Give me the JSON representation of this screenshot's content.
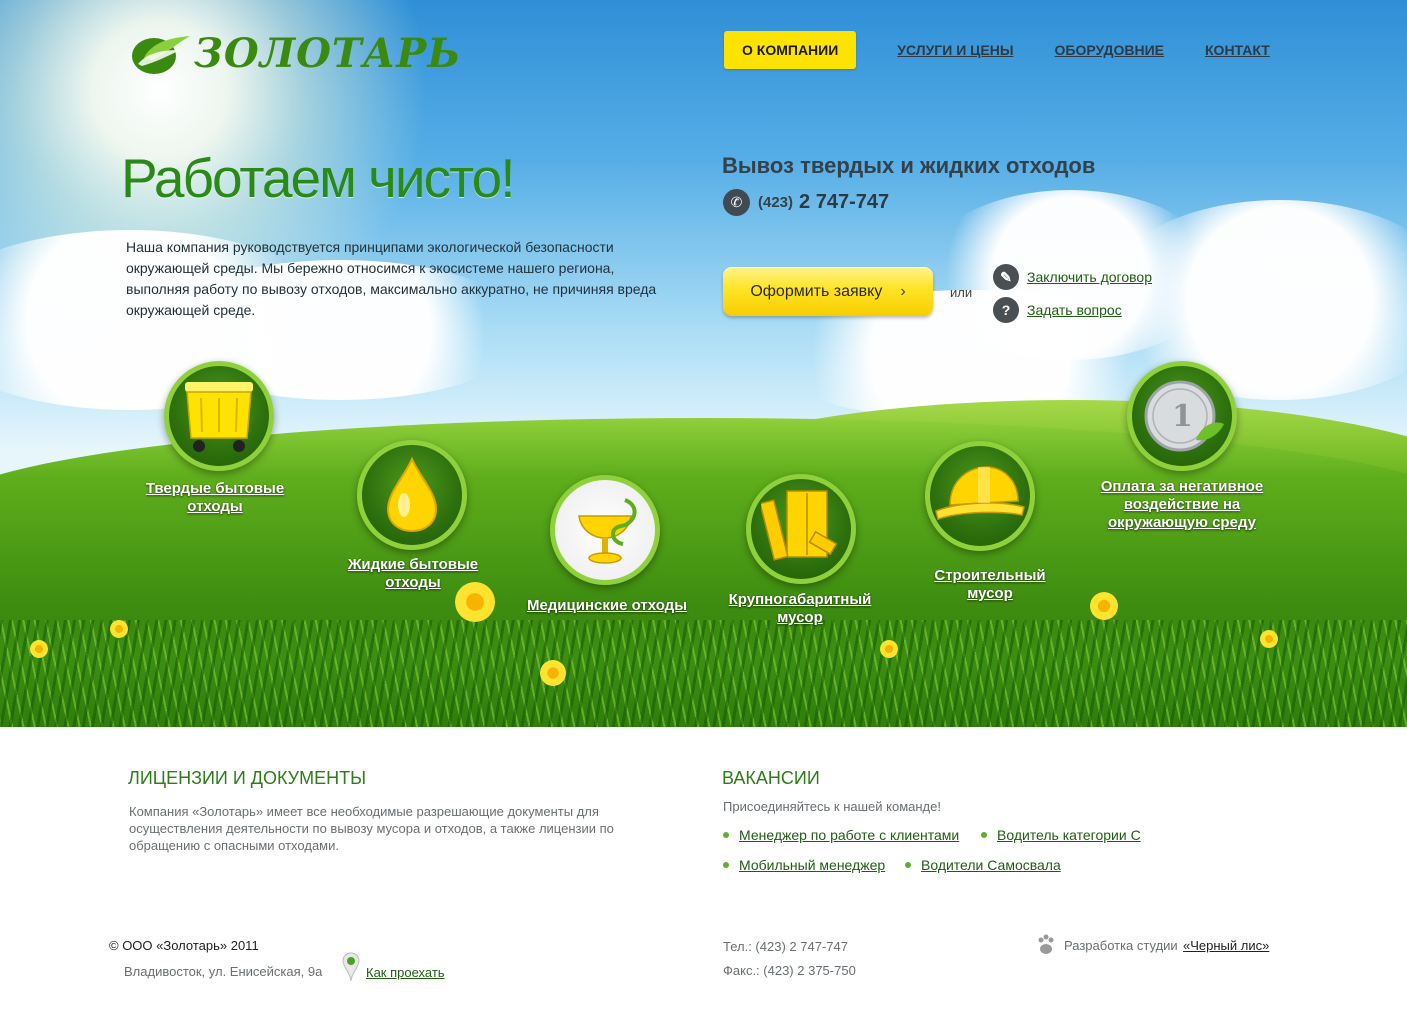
{
  "brand": {
    "name": "ЗОЛОТАРЬ"
  },
  "nav": [
    {
      "label": "О КОМПАНИИ",
      "active": true
    },
    {
      "label": "УСЛУГИ И ЦЕНЫ"
    },
    {
      "label": "ОБОРУДОВНИЕ"
    },
    {
      "label": "КОНТАКТ"
    }
  ],
  "hero": {
    "headline": "Работаем чисто!",
    "intro": "Наша компания руководствуется принципами экологической безопасности окружающей среды. Мы бережно относимся к экосистеме нашего региона, выполняя работу по вывозу отходов, максимально аккуратно, не причиняя вреда окружающей среде.",
    "service_title": "Вывоз твердых и жидких отходов",
    "phone_code": "(423)",
    "phone_number": "2 747-747",
    "order_button": "Оформить заявку",
    "or_text": "или",
    "contract_link": "Заключить договор",
    "question_link": "Задать вопрос"
  },
  "categories": [
    {
      "label": "Твердые бытовые отходы",
      "icon": "garbage-container-icon"
    },
    {
      "label": "Жидкие бытовые отходы",
      "icon": "liquid-drop-icon"
    },
    {
      "label": "Медицинские отходы",
      "icon": "medical-bowl-icon"
    },
    {
      "label": "Крупногабаритный мусор",
      "icon": "furniture-icon"
    },
    {
      "label": "Строительный мусор",
      "icon": "hard-hat-icon"
    },
    {
      "label": "Оплата за негативное воздействие на окружающую среду",
      "icon": "ruble-coin-icon"
    }
  ],
  "licenses": {
    "title": "ЛИЦЕНЗИИ И ДОКУМЕНТЫ",
    "text": "Компания «Золотарь» имеет все необходимые разрешающие документы для осуществления деятельности по вывозу мусора и отходов, а также лицензии по обращению с опасными отходами."
  },
  "vacancies": {
    "title": "ВАКАНСИИ",
    "subtitle": "Присоединяйтесь к нашей команде!",
    "items": [
      "Менеджер по работе с клиентами",
      "Водитель категории С",
      "Мобильный менеджер",
      "Водители Самосвала"
    ]
  },
  "footer": {
    "copyright": "© ООО «Золотарь» 2011",
    "address": "Владивосток, ул. Енисейская, 9а",
    "directions_link": "Как проехать",
    "tel": "Тел.: (423) 2 747-747",
    "fax": "Факс.: (423) 2 375-750",
    "studio_prefix": "Разработка студии",
    "studio_link": "«Черный лис»"
  },
  "colors": {
    "brand_green": "#2e7d18",
    "button_yellow": "#ffe300",
    "link_green": "#1f5e12"
  }
}
